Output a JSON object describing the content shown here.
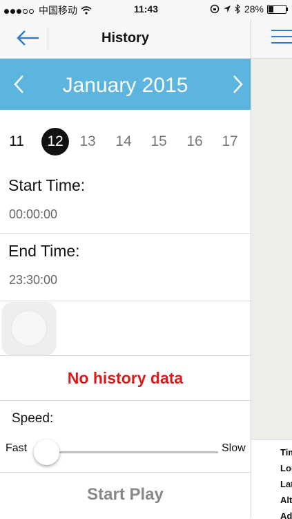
{
  "status_bar": {
    "carrier": "中国移动",
    "time": "11:43",
    "battery": "28%"
  },
  "nav": {
    "title": "History",
    "back_icon": "arrow-left-icon",
    "menu_icon": "hamburger-menu-icon"
  },
  "calendar": {
    "month_title": "January 2015",
    "days": [
      "11",
      "12",
      "13",
      "14",
      "15",
      "16",
      "17"
    ],
    "selected_day": "12"
  },
  "start_time": {
    "label": "Start Time:",
    "value": "00:00:00"
  },
  "end_time": {
    "label": "End Time:",
    "value": "23:30:00"
  },
  "status_message": "No history data",
  "speed": {
    "label": "Speed:",
    "fast_label": "Fast",
    "slow_label": "Slow",
    "slider_value_fraction": 0.0
  },
  "start_play_label": "Start Play",
  "side_panel": {
    "info_labels": [
      "Tim",
      "Lor",
      "Lat",
      "Alt",
      "Ad"
    ]
  },
  "colors": {
    "accent_blue": "#5bb5de",
    "icon_blue": "#2e7bd0",
    "error_red": "#dd1a1a"
  }
}
